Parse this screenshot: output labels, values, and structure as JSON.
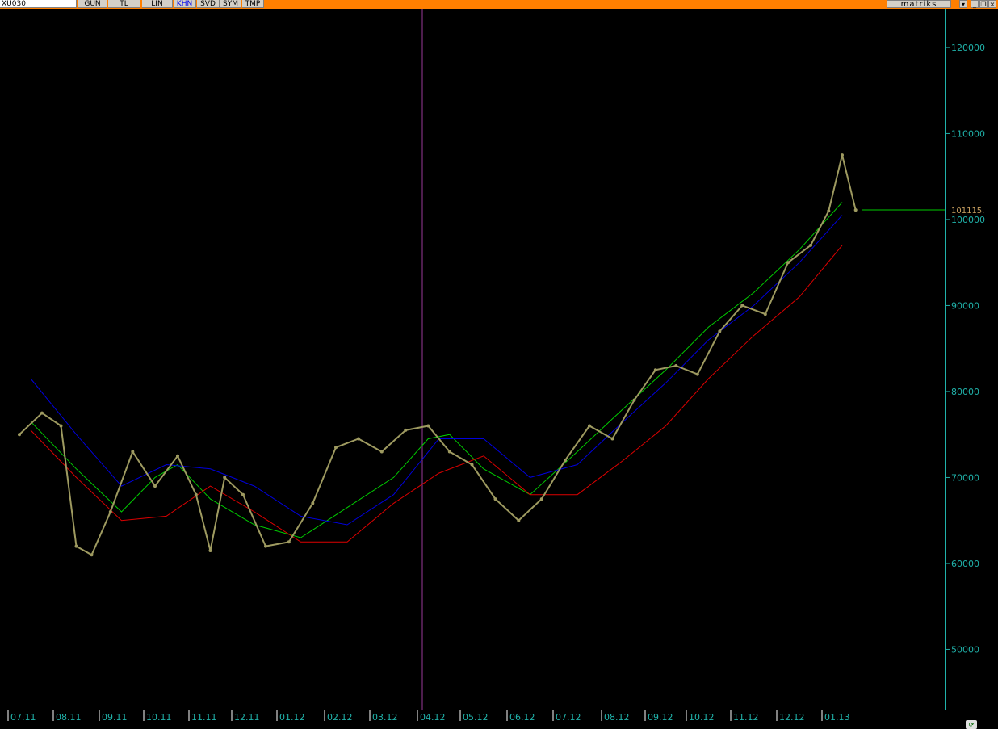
{
  "toolbar": {
    "symbol": "XU030",
    "buttons": [
      "GUN",
      "TL",
      "LIN",
      "KHN",
      "SVD",
      "SYM",
      "TMP"
    ],
    "active_button": "KHN",
    "brand": "matriks"
  },
  "colors": {
    "background": "#000000",
    "toolbar": "#ff7f00",
    "axis": "#20b2aa",
    "price": "#9e9a60",
    "green_line": "#00cc00",
    "blue_line": "#0000dd",
    "red_line": "#dd0000",
    "divider": "#9a3a9a",
    "last_price_label": "#c8a060"
  },
  "chart_data": {
    "type": "line",
    "x_tick_labels": [
      "07.11",
      "08.11",
      "09.11",
      "10.11",
      "11.11",
      "12.11",
      "01.12",
      "02.12",
      "03.12",
      "04.12",
      "05.12",
      "06.12",
      "07.12",
      "08.12",
      "09.12",
      "10.12",
      "11.12",
      "12.12",
      "01.13"
    ],
    "y_tick_labels": [
      "50000",
      "60000",
      "70000",
      "80000",
      "90000",
      "100000",
      "110000",
      "120000"
    ],
    "ylim": [
      43000,
      124500
    ],
    "last_price_label": "101115.",
    "last_price": 101115,
    "price_series": {
      "name": "",
      "x": [
        "07.11",
        "07.11",
        "08.11",
        "08.11",
        "08.11",
        "09.11",
        "09.11",
        "10.11",
        "10.11",
        "11.11",
        "11.11",
        "11.11",
        "12.11",
        "12.11",
        "01.12",
        "01.12",
        "02.12",
        "02.12",
        "03.12",
        "03.12",
        "04.12",
        "04.12",
        "05.12",
        "05.12",
        "06.12",
        "06.12",
        "07.12",
        "07.12",
        "08.12",
        "08.12",
        "09.12",
        "09.12",
        "10.12",
        "10.12",
        "11.12",
        "11.12",
        "12.12",
        "12.12",
        "01.13",
        "01.13",
        "01.13"
      ],
      "y": [
        75000,
        77500,
        76000,
        62000,
        61000,
        66000,
        73000,
        69000,
        72500,
        68000,
        61500,
        70000,
        68000,
        62000,
        62500,
        67000,
        73500,
        74500,
        73000,
        75500,
        76000,
        73000,
        71500,
        67500,
        65000,
        67500,
        72000,
        76000,
        74500,
        79000,
        82500,
        83000,
        82000,
        87000,
        90000,
        89000,
        95000,
        97000,
        101000,
        107500,
        101115
      ]
    },
    "indicator_series": [
      {
        "name": "",
        "color": "#00cc00",
        "x": [
          "07.11",
          "08.11",
          "09.11",
          "10.11",
          "10.11",
          "11.11",
          "12.11",
          "01.12",
          "02.12",
          "03.12",
          "04.12",
          "04.12",
          "05.12",
          "06.12",
          "07.12",
          "08.12",
          "09.12",
          "10.12",
          "11.12",
          "12.12",
          "01.13"
        ],
        "y": [
          76500,
          71000,
          66000,
          70000,
          71500,
          67500,
          64500,
          63000,
          66500,
          70000,
          74500,
          75000,
          71000,
          68000,
          73000,
          78000,
          82500,
          87500,
          91500,
          96500,
          102000
        ]
      },
      {
        "name": "",
        "color": "#0000dd",
        "x": [
          "07.11",
          "08.11",
          "09.11",
          "10.11",
          "11.11",
          "12.11",
          "01.12",
          "02.12",
          "03.12",
          "04.12",
          "05.12",
          "06.12",
          "07.12",
          "08.12",
          "09.12",
          "10.12",
          "11.12",
          "12.12",
          "01.13"
        ],
        "y": [
          81500,
          75000,
          69000,
          71500,
          71000,
          69000,
          65500,
          64500,
          68000,
          74500,
          74500,
          70000,
          71500,
          76500,
          81000,
          86000,
          90000,
          95000,
          100500
        ]
      },
      {
        "name": "",
        "color": "#dd0000",
        "x": [
          "07.11",
          "08.11",
          "09.11",
          "10.11",
          "11.11",
          "12.11",
          "01.12",
          "02.12",
          "03.12",
          "04.12",
          "05.12",
          "06.12",
          "07.12",
          "08.12",
          "09.12",
          "10.12",
          "11.12",
          "12.12",
          "01.13"
        ],
        "y": [
          75500,
          70000,
          65000,
          65500,
          69000,
          66000,
          62500,
          62500,
          67000,
          70500,
          72500,
          68000,
          68000,
          72000,
          76000,
          81500,
          86500,
          91000,
          97000
        ]
      }
    ],
    "vertical_marker": "04.12",
    "grid": false,
    "title": "",
    "xlabel": "",
    "ylabel": ""
  }
}
